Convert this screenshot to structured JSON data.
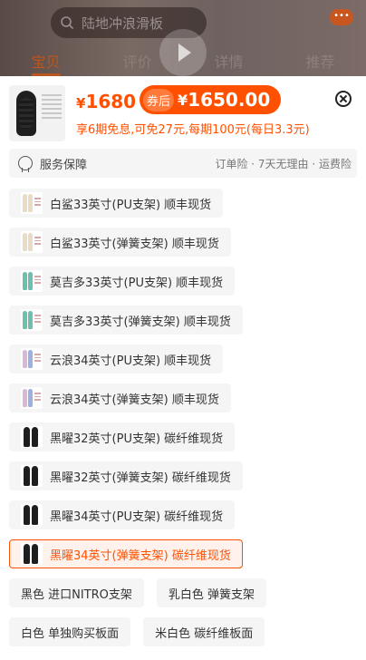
{
  "header": {
    "search_placeholder": "陆地冲浪滑板",
    "tabs": [
      "宝贝",
      "评价",
      "详情",
      "推荐"
    ],
    "active_tab": 0,
    "more_label": "•••"
  },
  "product": {
    "price_prefix": "¥",
    "price": "1680",
    "coupon_label": "券后",
    "coupon_prefix": "¥",
    "coupon_price": "1650.00",
    "installment": "享6期免息,可免27元,每期100元(每日3.3元)"
  },
  "service": {
    "title": "服务保障",
    "detail": "订单险 · 7天无理由 · 运费险"
  },
  "options": [
    {
      "label": "白鲨33英寸(PU支架)   顺丰现货",
      "swatch": "white",
      "selected": false
    },
    {
      "label": "白鲨33英寸(弹簧支架)   顺丰现货",
      "swatch": "white",
      "selected": false
    },
    {
      "label": "莫吉多33英寸(PU支架)   顺丰现货",
      "swatch": "teal",
      "selected": false
    },
    {
      "label": "莫吉多33英寸(弹簧支架)   顺丰现货",
      "swatch": "teal",
      "selected": false
    },
    {
      "label": "云浪34英寸(PU支架)   顺丰现货",
      "swatch": "cloud",
      "selected": false
    },
    {
      "label": "云浪34英寸(弹簧支架)   顺丰现货",
      "swatch": "cloud",
      "selected": false
    },
    {
      "label": "黑曜32英寸(PU支架)   碳纤维现货",
      "swatch": "dark",
      "selected": false
    },
    {
      "label": "黑曜32英寸(弹簧支架)   碳纤维现货",
      "swatch": "dark",
      "selected": false
    },
    {
      "label": "黑曜34英寸(PU支架)   碳纤维现货",
      "swatch": "dark",
      "selected": false
    },
    {
      "label": "黑曜34英寸(弹簧支架)   碳纤维现货",
      "swatch": "dark",
      "selected": true
    }
  ],
  "color_options": [
    {
      "label": "黑色 进口NITRO支架"
    },
    {
      "label": "乳白色 弹簧支架"
    },
    {
      "label": "白色 单独购买板面"
    },
    {
      "label": "米白色 碳纤维板面"
    }
  ],
  "colors": {
    "accent": "#ff5000",
    "swatch_white": "#e9dcc4",
    "swatch_teal": "#6fbfae",
    "swatch_cloud": "#d9b7d9",
    "swatch_dark": "#1e1e1e"
  }
}
